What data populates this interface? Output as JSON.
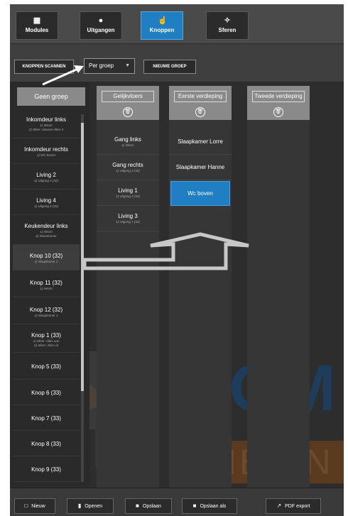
{
  "topnav": {
    "items": [
      {
        "label": "Modules",
        "icon": "grid-icon",
        "active": false
      },
      {
        "label": "Uitgangen",
        "icon": "bulb-icon",
        "active": false
      },
      {
        "label": "Knoppen",
        "icon": "hand-icon",
        "active": true
      },
      {
        "label": "Sferen",
        "icon": "sparkle-icon",
        "active": false
      }
    ]
  },
  "toolbar": {
    "scan_label": "KNOPPEN SCANNEN",
    "group_select": "Per groep",
    "new_group_label": "NIEUWE GROEP"
  },
  "left": {
    "header": "Geen groep",
    "items": [
      {
        "title": "Inkomdeur links",
        "sub": [
          "1) Inkom",
          "2) Sfeer: Nieuwe sfeer 4"
        ]
      },
      {
        "title": "Inkomdeur rechts",
        "sub": [
          "1) WC boven"
        ]
      },
      {
        "title": "Living 2",
        "sub": [
          "1) Uitgang 4 (32)"
        ]
      },
      {
        "title": "Living 4",
        "sub": [
          "1) Uitgang 8 (32)"
        ]
      },
      {
        "title": "Keukendeur links",
        "sub": [
          "1) Inkom",
          "2) Woonkamer"
        ]
      },
      {
        "title": "Knop 10 (32)",
        "sub": [
          "1) Slaapkamer 2"
        ]
      },
      {
        "title": "Knop 11 (32)",
        "sub": [
          "1) Inkom"
        ]
      },
      {
        "title": "Knop 12 (32)",
        "sub": [
          "1) Slaapkamer 1"
        ]
      },
      {
        "title": "Knop 1 (33)",
        "sub": [
          "1) Sfeer: Alles aan",
          "2) Sfeer: Alles uit"
        ]
      },
      {
        "title": "Knop 5 (33)",
        "sub": []
      },
      {
        "title": "Knop 6 (33)",
        "sub": []
      },
      {
        "title": "Knop 7 (33)",
        "sub": []
      },
      {
        "title": "Knop 8 (33)",
        "sub": []
      },
      {
        "title": "Knop 9 (33)",
        "sub": []
      }
    ]
  },
  "groups": [
    {
      "title": "Gelijkvloers",
      "items": [
        {
          "title": "Gang links",
          "sub": "1) Inkom"
        },
        {
          "title": "Gang rechts",
          "sub": "1) Uitgang 3 (32)"
        },
        {
          "title": "Living 1",
          "sub": "1) Uitgang 3 (32)"
        },
        {
          "title": "Living 3",
          "sub": "1) Uitgang 7 (32)"
        }
      ]
    },
    {
      "title": "Eerste verdieping",
      "items": [
        {
          "title": "Slaapkamer Lorre",
          "sub": ""
        },
        {
          "title": "Slaapkamer Hanne",
          "sub": ""
        },
        {
          "title": "Wc boven",
          "sub": "",
          "selected": true
        }
      ]
    },
    {
      "title": "Tweede verdieping",
      "items": []
    }
  ],
  "watermark": {
    "line1": "DOM",
    "line2": "AMBIAN"
  },
  "bottombar": {
    "new_label": "Nieuw",
    "open_label": "Openen",
    "save_label": "Opslaan",
    "saveas_label": "Opslaan als",
    "pdf_label": "PDF export"
  },
  "colors": {
    "accent": "#1f7fc2",
    "background": "#2d2d2d",
    "header_gray": "#8a8a8a"
  }
}
